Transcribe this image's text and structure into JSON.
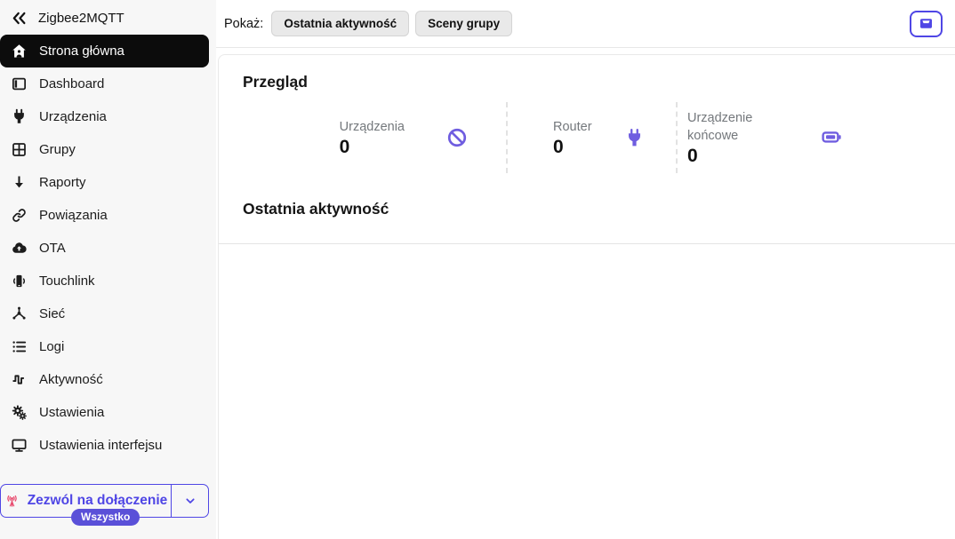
{
  "sidebar": {
    "brand": "Zigbee2MQTT",
    "items": [
      {
        "label": "Strona główna",
        "icon": "home-icon",
        "active": true
      },
      {
        "label": "Dashboard",
        "icon": "dashboard-icon",
        "active": false
      },
      {
        "label": "Urządzenia",
        "icon": "plug-icon",
        "active": false
      },
      {
        "label": "Grupy",
        "icon": "grid-icon",
        "active": false
      },
      {
        "label": "Raporty",
        "icon": "arrow-down-icon",
        "active": false
      },
      {
        "label": "Powiązania",
        "icon": "link-icon",
        "active": false
      },
      {
        "label": "OTA",
        "icon": "cloud-upload-icon",
        "active": false
      },
      {
        "label": "Touchlink",
        "icon": "phone-waves-icon",
        "active": false
      },
      {
        "label": "Sieć",
        "icon": "network-icon",
        "active": false
      },
      {
        "label": "Logi",
        "icon": "list-icon",
        "active": false
      },
      {
        "label": "Aktywność",
        "icon": "activity-icon",
        "active": false
      },
      {
        "label": "Ustawienia",
        "icon": "gears-icon",
        "active": false
      },
      {
        "label": "Ustawienia interfejsu",
        "icon": "monitor-icon",
        "active": false
      }
    ],
    "join_button": {
      "label": "Zezwól na dołączenie",
      "badge": "Wszystko"
    }
  },
  "topbar": {
    "show_label": "Pokaż:",
    "buttons": [
      {
        "label": "Ostatnia aktywność"
      },
      {
        "label": "Sceny grupy"
      }
    ]
  },
  "overview": {
    "title": "Przegląd",
    "stats": [
      {
        "label": "Urządzenia",
        "value": "0",
        "icon": "prohibit-icon"
      },
      {
        "label": "Router",
        "value": "0",
        "icon": "plug-icon"
      },
      {
        "label": "Urządzenie końcowe",
        "value": "0",
        "icon": "battery-icon"
      }
    ]
  },
  "activity": {
    "title": "Ostatnia aktywność"
  },
  "colors": {
    "accent": "#4f46e5",
    "badge": "#5a50d8",
    "stat_icon": "#6f5de0",
    "broadcast": "#e8476b",
    "sidebar_bg": "#f7f7f7",
    "active_item_bg": "#0c0c0c"
  }
}
